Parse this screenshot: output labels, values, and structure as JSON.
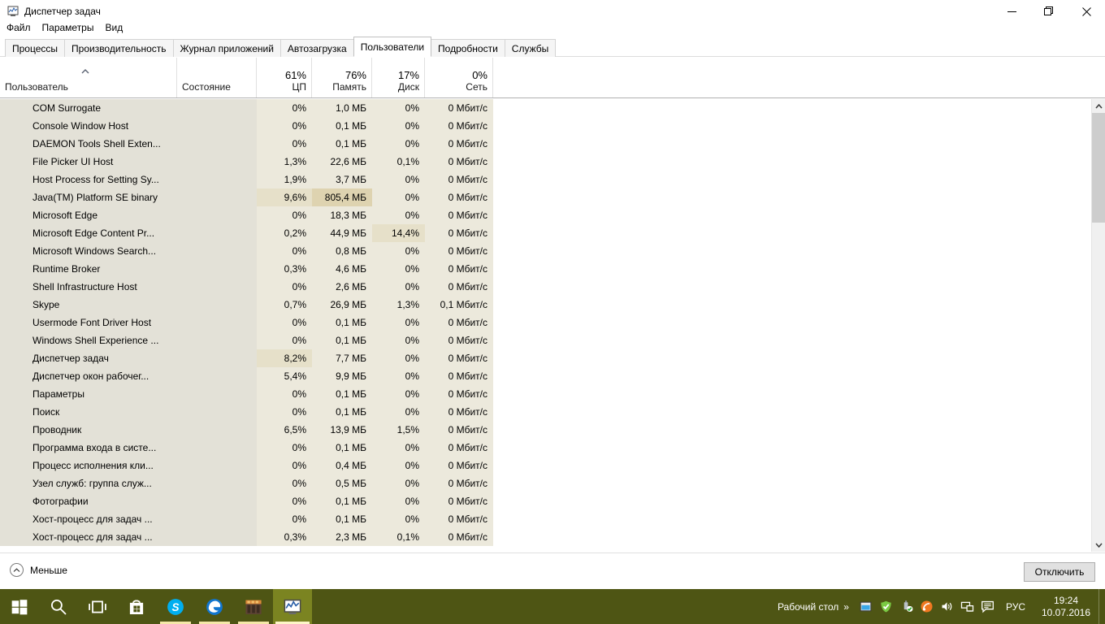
{
  "window": {
    "title": "Диспетчер задач",
    "icon": "task-manager-icon",
    "minimize_label": "—",
    "maximize_label": "❐",
    "close_label": "✕"
  },
  "menu": {
    "items": [
      {
        "label": "Файл"
      },
      {
        "label": "Параметры"
      },
      {
        "label": "Вид"
      }
    ]
  },
  "tabs": [
    {
      "label": "Процессы",
      "active": false
    },
    {
      "label": "Производительность",
      "active": false
    },
    {
      "label": "Журнал приложений",
      "active": false
    },
    {
      "label": "Автозагрузка",
      "active": false
    },
    {
      "label": "Пользователи",
      "active": true
    },
    {
      "label": "Подробности",
      "active": false
    },
    {
      "label": "Службы",
      "active": false
    }
  ],
  "columns": [
    {
      "key": "user",
      "label": "Пользователь",
      "pct": "",
      "align": "left"
    },
    {
      "key": "state",
      "label": "Состояние",
      "pct": "",
      "align": "left"
    },
    {
      "key": "cpu",
      "label": "ЦП",
      "pct": "61%",
      "align": "right"
    },
    {
      "key": "memory",
      "label": "Память",
      "pct": "76%",
      "align": "right"
    },
    {
      "key": "disk",
      "label": "Диск",
      "pct": "17%",
      "align": "right"
    },
    {
      "key": "network",
      "label": "Сеть",
      "pct": "0%",
      "align": "right"
    }
  ],
  "sort": {
    "column": "user",
    "direction": "asc",
    "indicator": "chevron-up-icon"
  },
  "rows": [
    {
      "name": "COM Surrogate",
      "icon": "generic-app-icon",
      "state": "",
      "cpu": "0%",
      "memory": "1,0 МБ",
      "disk": "0%",
      "network": "0 Мбит/с",
      "heat": {
        "cpu": 0,
        "memory": 0,
        "disk": 0,
        "network": 0
      }
    },
    {
      "name": "Console Window Host",
      "icon": "console-icon",
      "state": "",
      "cpu": "0%",
      "memory": "0,1 МБ",
      "disk": "0%",
      "network": "0 Мбит/с",
      "heat": {
        "cpu": 0,
        "memory": 0,
        "disk": 0,
        "network": 0
      }
    },
    {
      "name": "DAEMON Tools Shell Exten...",
      "icon": "daemon-tools-icon",
      "state": "",
      "cpu": "0%",
      "memory": "0,1 МБ",
      "disk": "0%",
      "network": "0 Мбит/с",
      "heat": {
        "cpu": 0,
        "memory": 0,
        "disk": 0,
        "network": 0
      }
    },
    {
      "name": "File Picker UI Host",
      "icon": "generic-app-icon",
      "state": "",
      "cpu": "1,3%",
      "memory": "22,6 МБ",
      "disk": "0,1%",
      "network": "0 Мбит/с",
      "heat": {
        "cpu": 1,
        "memory": 1,
        "disk": 1,
        "network": 0
      }
    },
    {
      "name": "Host Process for Setting Sy...",
      "icon": "generic-app-icon",
      "state": "",
      "cpu": "1,9%",
      "memory": "3,7 МБ",
      "disk": "0%",
      "network": "0 Мбит/с",
      "heat": {
        "cpu": 1,
        "memory": 0,
        "disk": 0,
        "network": 0
      }
    },
    {
      "name": "Java(TM) Platform SE binary",
      "icon": "java-icon",
      "state": "",
      "cpu": "9,6%",
      "memory": "805,4 МБ",
      "disk": "0%",
      "network": "0 Мбит/с",
      "heat": {
        "cpu": 2,
        "memory": 3,
        "disk": 0,
        "network": 0
      }
    },
    {
      "name": "Microsoft Edge",
      "icon": "edge-icon",
      "state": "",
      "cpu": "0%",
      "memory": "18,3 МБ",
      "disk": "0%",
      "network": "0 Мбит/с",
      "heat": {
        "cpu": 0,
        "memory": 1,
        "disk": 0,
        "network": 0
      }
    },
    {
      "name": "Microsoft Edge Content Pr...",
      "icon": "edge-icon",
      "state": "",
      "cpu": "0,2%",
      "memory": "44,9 МБ",
      "disk": "14,4%",
      "network": "0 Мбит/с",
      "heat": {
        "cpu": 0,
        "memory": 1,
        "disk": 2,
        "network": 0
      }
    },
    {
      "name": "Microsoft Windows Search...",
      "icon": "search-user-icon",
      "state": "",
      "cpu": "0%",
      "memory": "0,8 МБ",
      "disk": "0%",
      "network": "0 Мбит/с",
      "heat": {
        "cpu": 0,
        "memory": 0,
        "disk": 0,
        "network": 0
      }
    },
    {
      "name": "Runtime Broker",
      "icon": "generic-app-icon",
      "state": "",
      "cpu": "0,3%",
      "memory": "4,6 МБ",
      "disk": "0%",
      "network": "0 Мбит/с",
      "heat": {
        "cpu": 0,
        "memory": 0,
        "disk": 0,
        "network": 0
      }
    },
    {
      "name": "Shell Infrastructure Host",
      "icon": "generic-app-icon",
      "state": "",
      "cpu": "0%",
      "memory": "2,6 МБ",
      "disk": "0%",
      "network": "0 Мбит/с",
      "heat": {
        "cpu": 0,
        "memory": 0,
        "disk": 0,
        "network": 0
      }
    },
    {
      "name": "Skype",
      "icon": "skype-icon",
      "state": "",
      "cpu": "0,7%",
      "memory": "26,9 МБ",
      "disk": "1,3%",
      "network": "0,1 Мбит/с",
      "heat": {
        "cpu": 0,
        "memory": 1,
        "disk": 1,
        "network": 0
      }
    },
    {
      "name": "Usermode Font Driver Host",
      "icon": "generic-app-icon",
      "state": "",
      "cpu": "0%",
      "memory": "0,1 МБ",
      "disk": "0%",
      "network": "0 Мбит/с",
      "heat": {
        "cpu": 0,
        "memory": 0,
        "disk": 0,
        "network": 0
      }
    },
    {
      "name": "Windows Shell Experience ...",
      "icon": "shell-experience-icon",
      "state": "",
      "cpu": "0%",
      "memory": "0,1 МБ",
      "disk": "0%",
      "network": "0 Мбит/с",
      "heat": {
        "cpu": 0,
        "memory": 0,
        "disk": 0,
        "network": 0
      }
    },
    {
      "name": "Диспетчер задач",
      "icon": "task-manager-icon",
      "state": "",
      "cpu": "8,2%",
      "memory": "7,7 МБ",
      "disk": "0%",
      "network": "0 Мбит/с",
      "heat": {
        "cpu": 2,
        "memory": 0,
        "disk": 0,
        "network": 0
      }
    },
    {
      "name": "Диспетчер окон рабочег...",
      "icon": "generic-app-icon",
      "state": "",
      "cpu": "5,4%",
      "memory": "9,9 МБ",
      "disk": "0%",
      "network": "0 Мбит/с",
      "heat": {
        "cpu": 1,
        "memory": 1,
        "disk": 0,
        "network": 0
      }
    },
    {
      "name": "Параметры",
      "icon": "settings-gear-icon",
      "state": "",
      "cpu": "0%",
      "memory": "0,1 МБ",
      "disk": "0%",
      "network": "0 Мбит/с",
      "heat": {
        "cpu": 0,
        "memory": 0,
        "disk": 0,
        "network": 0
      }
    },
    {
      "name": "Поиск",
      "icon": "search-icon",
      "state": "",
      "cpu": "0%",
      "memory": "0,1 МБ",
      "disk": "0%",
      "network": "0 Мбит/с",
      "heat": {
        "cpu": 0,
        "memory": 0,
        "disk": 0,
        "network": 0
      }
    },
    {
      "name": "Проводник",
      "icon": "file-explorer-icon",
      "state": "",
      "cpu": "6,5%",
      "memory": "13,9 МБ",
      "disk": "1,5%",
      "network": "0 Мбит/с",
      "heat": {
        "cpu": 1,
        "memory": 1,
        "disk": 1,
        "network": 0
      }
    },
    {
      "name": "Программа входа в систе...",
      "icon": "logon-icon",
      "state": "",
      "cpu": "0%",
      "memory": "0,1 МБ",
      "disk": "0%",
      "network": "0 Мбит/с",
      "heat": {
        "cpu": 0,
        "memory": 0,
        "disk": 0,
        "network": 0
      }
    },
    {
      "name": "Процесс исполнения кли...",
      "icon": "generic-app-icon",
      "state": "",
      "cpu": "0%",
      "memory": "0,4 МБ",
      "disk": "0%",
      "network": "0 Мбит/с",
      "heat": {
        "cpu": 0,
        "memory": 0,
        "disk": 0,
        "network": 0
      }
    },
    {
      "name": "Узел служб: группа служ...",
      "icon": "service-host-icon",
      "state": "",
      "cpu": "0%",
      "memory": "0,5 МБ",
      "disk": "0%",
      "network": "0 Мбит/с",
      "heat": {
        "cpu": 0,
        "memory": 0,
        "disk": 0,
        "network": 0
      }
    },
    {
      "name": "Фотографии",
      "icon": "photos-icon",
      "state": "",
      "cpu": "0%",
      "memory": "0,1 МБ",
      "disk": "0%",
      "network": "0 Мбит/с",
      "heat": {
        "cpu": 0,
        "memory": 0,
        "disk": 0,
        "network": 0
      }
    },
    {
      "name": "Хост-процесс для задач ...",
      "icon": "generic-app-icon",
      "state": "",
      "cpu": "0%",
      "memory": "0,1 МБ",
      "disk": "0%",
      "network": "0 Мбит/с",
      "heat": {
        "cpu": 0,
        "memory": 0,
        "disk": 0,
        "network": 0
      }
    },
    {
      "name": "Хост-процесс для задач ...",
      "icon": "generic-app-icon",
      "state": "",
      "cpu": "0,3%",
      "memory": "2,3 МБ",
      "disk": "0,1%",
      "network": "0 Мбит/с",
      "heat": {
        "cpu": 0,
        "memory": 0,
        "disk": 0,
        "network": 0
      }
    }
  ],
  "bottom": {
    "fewer_label": "Меньше",
    "fewer_icon": "chevron-up-circle-icon",
    "end_task_label": "Отключить"
  },
  "taskbar": {
    "buttons": [
      {
        "name": "start",
        "icon": "windows-logo-icon",
        "state": "normal"
      },
      {
        "name": "search",
        "icon": "search-icon",
        "state": "normal"
      },
      {
        "name": "task-view",
        "icon": "task-view-icon",
        "state": "normal"
      },
      {
        "name": "store",
        "icon": "store-bag-icon",
        "state": "normal"
      },
      {
        "name": "skype",
        "icon": "skype-icon",
        "state": "running"
      },
      {
        "name": "edge",
        "icon": "edge-icon",
        "state": "running"
      },
      {
        "name": "minecraft",
        "icon": "minecraft-icon",
        "state": "running"
      },
      {
        "name": "task-manager",
        "icon": "task-manager-icon",
        "state": "active"
      }
    ],
    "show_desktop_text": "Рабочий стол",
    "tray_overflow": "»",
    "tray_icons": [
      {
        "name": "display-icon"
      },
      {
        "name": "shield-check-icon"
      },
      {
        "name": "usb-safe-remove-icon"
      },
      {
        "name": "orange-app-icon"
      },
      {
        "name": "volume-icon"
      },
      {
        "name": "network-icon"
      },
      {
        "name": "action-center-icon"
      }
    ],
    "language": "РУС",
    "clock_time": "19:24",
    "clock_date": "10.07.2016"
  },
  "colors": {
    "row_name_bg": "#e3e1d7",
    "heat_1": "#ece9dc",
    "heat_2": "#e6e0c9",
    "heat_3": "#ded3b0",
    "taskbar_bg": "#4e5514",
    "accent": "#0078d7"
  }
}
